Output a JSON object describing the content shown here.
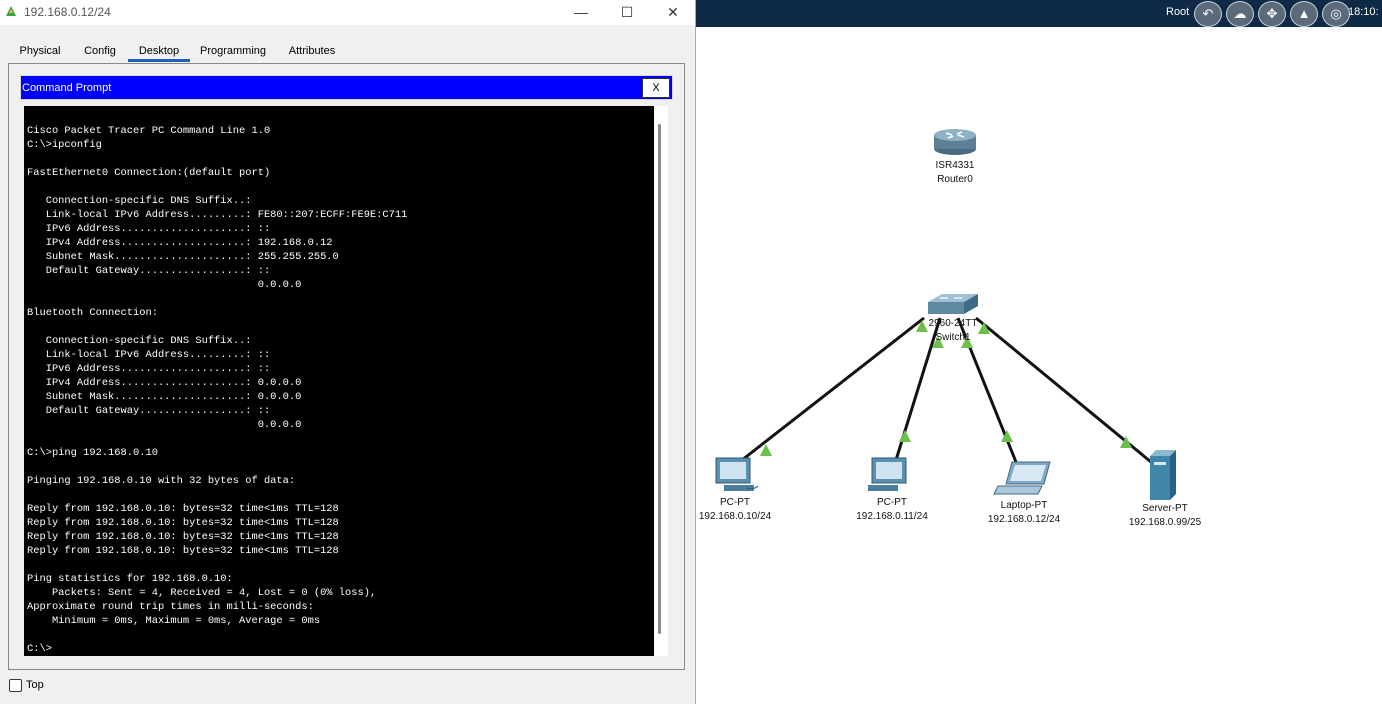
{
  "window": {
    "title": "192.168.0.12/24"
  },
  "tabs": [
    {
      "label": "Physical"
    },
    {
      "label": "Config"
    },
    {
      "label": "Desktop",
      "active": true
    },
    {
      "label": "Programming"
    },
    {
      "label": "Attributes"
    }
  ],
  "command_prompt": {
    "header": "Command Prompt",
    "close_label": "X",
    "lines": [
      "Cisco Packet Tracer PC Command Line 1.0",
      "C:\\>ipconfig",
      "",
      "FastEthernet0 Connection:(default port)",
      "",
      "   Connection-specific DNS Suffix..:",
      "   Link-local IPv6 Address.........: FE80::207:ECFF:FE9E:C711",
      "   IPv6 Address....................: ::",
      "   IPv4 Address....................: 192.168.0.12",
      "   Subnet Mask.....................: 255.255.255.0",
      "   Default Gateway.................: ::",
      "                                     0.0.0.0",
      "",
      "Bluetooth Connection:",
      "",
      "   Connection-specific DNS Suffix..:",
      "   Link-local IPv6 Address.........: ::",
      "   IPv6 Address....................: ::",
      "   IPv4 Address....................: 0.0.0.0",
      "   Subnet Mask.....................: 0.0.0.0",
      "   Default Gateway.................: ::",
      "                                     0.0.0.0",
      "",
      "C:\\>ping 192.168.0.10",
      "",
      "Pinging 192.168.0.10 with 32 bytes of data:",
      "",
      "Reply from 192.168.0.10: bytes=32 time<1ms TTL=128",
      "Reply from 192.168.0.10: bytes=32 time<1ms TTL=128",
      "Reply from 192.168.0.10: bytes=32 time<1ms TTL=128",
      "Reply from 192.168.0.10: bytes=32 time<1ms TTL=128",
      "",
      "Ping statistics for 192.168.0.10:",
      "    Packets: Sent = 4, Received = 4, Lost = 0 (0% loss),",
      "Approximate round trip times in milli-seconds:",
      "    Minimum = 0ms, Maximum = 0ms, Average = 0ms",
      "",
      "C:\\>"
    ]
  },
  "top_checkbox": {
    "label": "Top",
    "checked": false
  },
  "workspace_toolbar": {
    "root_label": "Root",
    "clock": "18:10:"
  },
  "topology": {
    "router": {
      "model": "ISR4331",
      "name": "Router0"
    },
    "switch": {
      "model": "2960-24TT",
      "name": "Switch1"
    },
    "devices": [
      {
        "type": "PC-PT",
        "label": "192.168.0.10/24"
      },
      {
        "type": "PC-PT",
        "label": "192.168.0.11/24"
      },
      {
        "type": "Laptop-PT",
        "label": "192.168.0.12/24"
      },
      {
        "type": "Server-PT",
        "label": "192.168.0.99/25"
      }
    ],
    "link_status_color": "#6cc04a"
  }
}
